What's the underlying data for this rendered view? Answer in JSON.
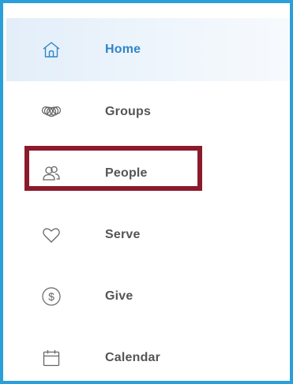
{
  "nav": {
    "items": [
      {
        "label": "Home",
        "icon": "home-icon",
        "active": true
      },
      {
        "label": "Groups",
        "icon": "groups-icon",
        "active": false
      },
      {
        "label": "People",
        "icon": "people-icon",
        "active": false
      },
      {
        "label": "Serve",
        "icon": "heart-icon",
        "active": false
      },
      {
        "label": "Give",
        "icon": "dollar-icon",
        "active": false
      },
      {
        "label": "Calendar",
        "icon": "calendar-icon",
        "active": false
      }
    ]
  },
  "colors": {
    "frame_border": "#2a9fd8",
    "active_accent": "#2f86c8",
    "active_background": "#e8f1fa",
    "text": "#555555",
    "icon_stroke": "#666666",
    "highlight_box": "#8b1a2b"
  }
}
